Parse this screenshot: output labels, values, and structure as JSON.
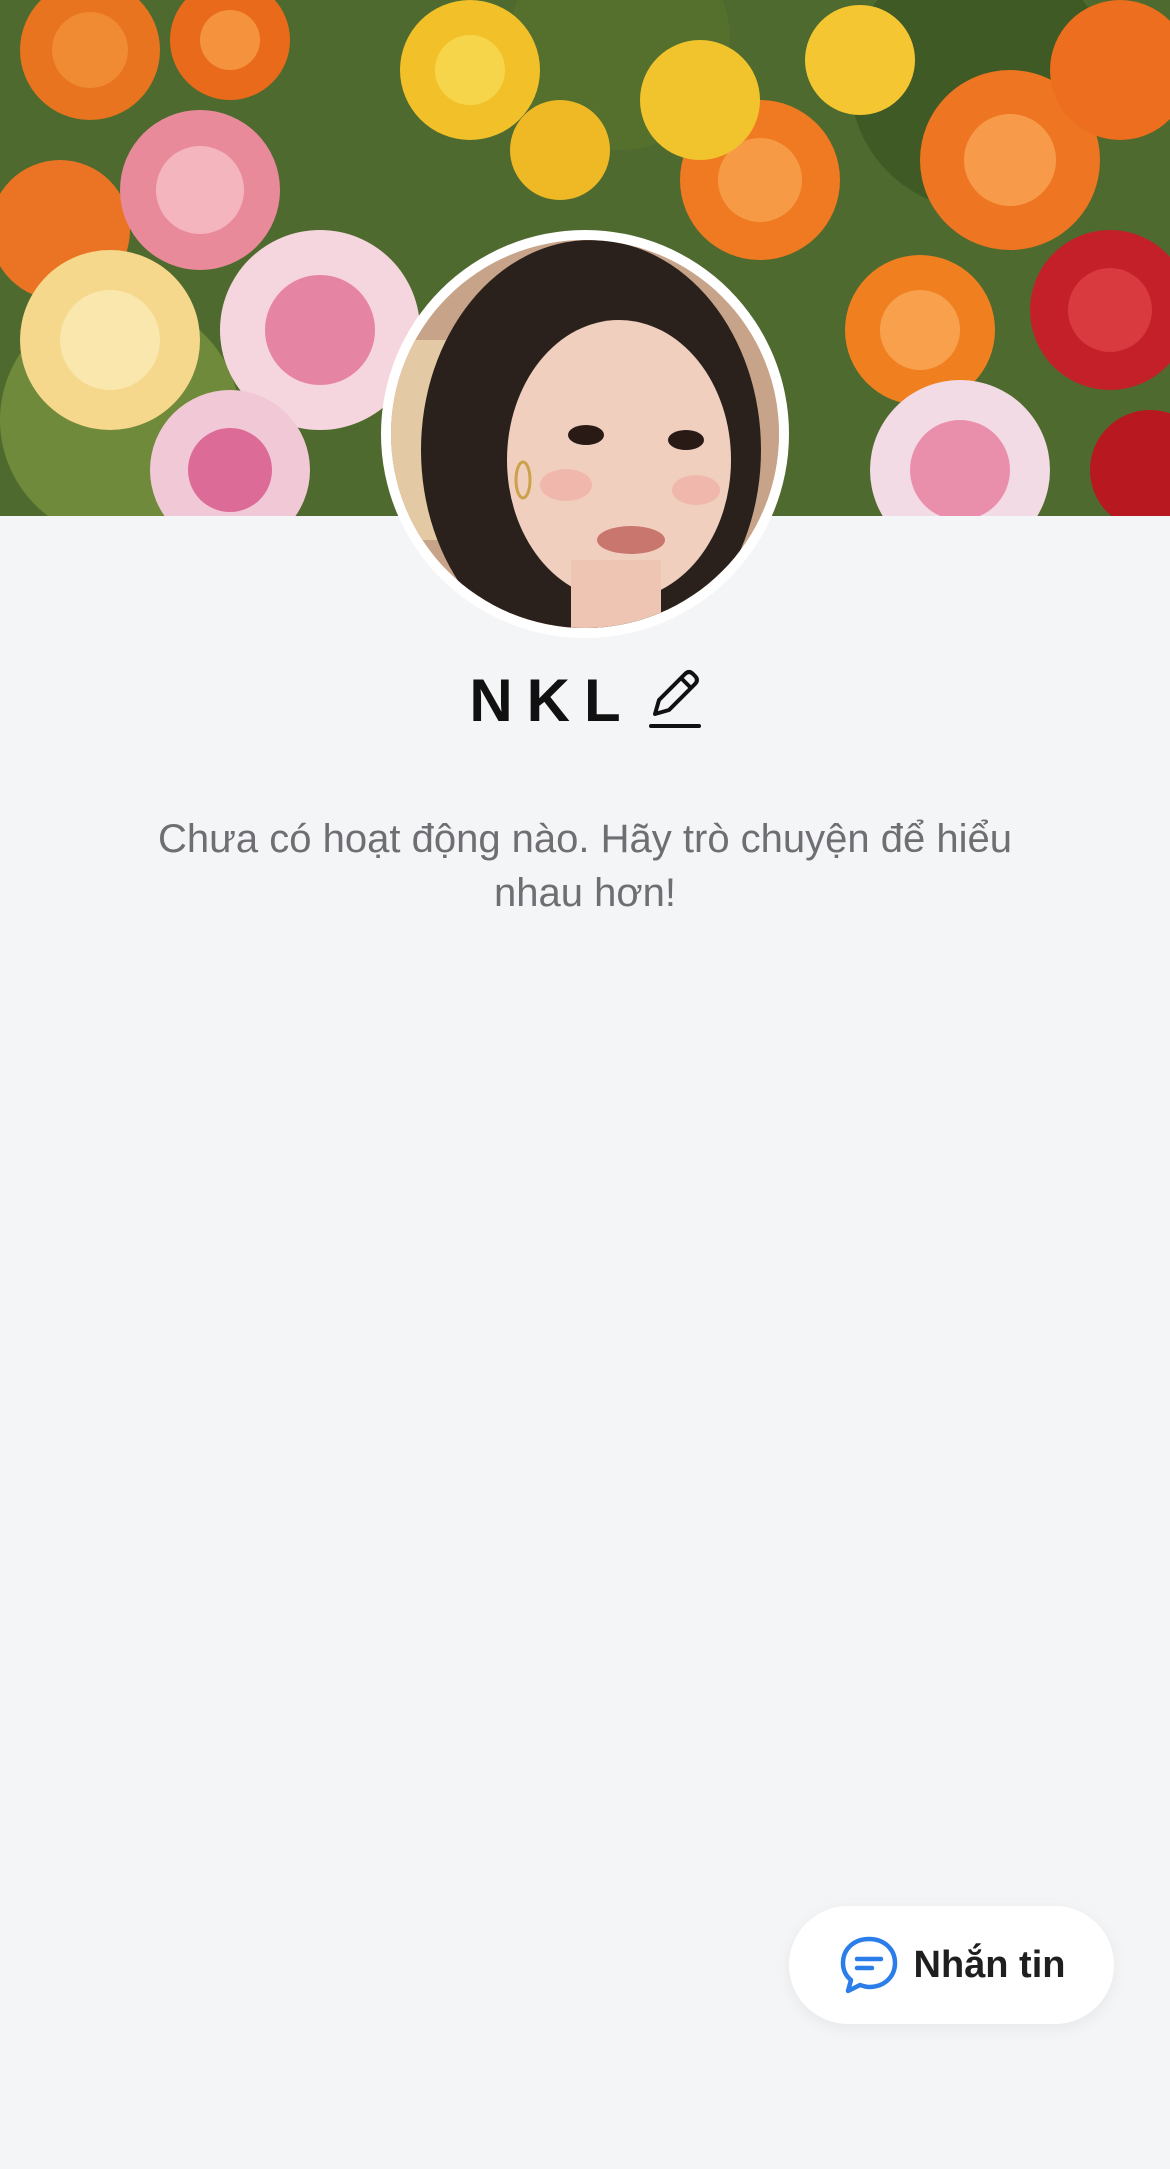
{
  "profile": {
    "name": "NKL",
    "empty_activity_message": "Chưa có hoạt động nào. Hãy trò chuyện để hiểu nhau hơn!"
  },
  "actions": {
    "message_label": "Nhắn tin"
  },
  "icons": {
    "edit": "pencil-icon",
    "message": "chat-bubble-icon"
  },
  "colors": {
    "background": "#f4f5f7",
    "accent": "#2b7de9",
    "text_primary": "#111111",
    "text_secondary": "#6e6e73"
  }
}
